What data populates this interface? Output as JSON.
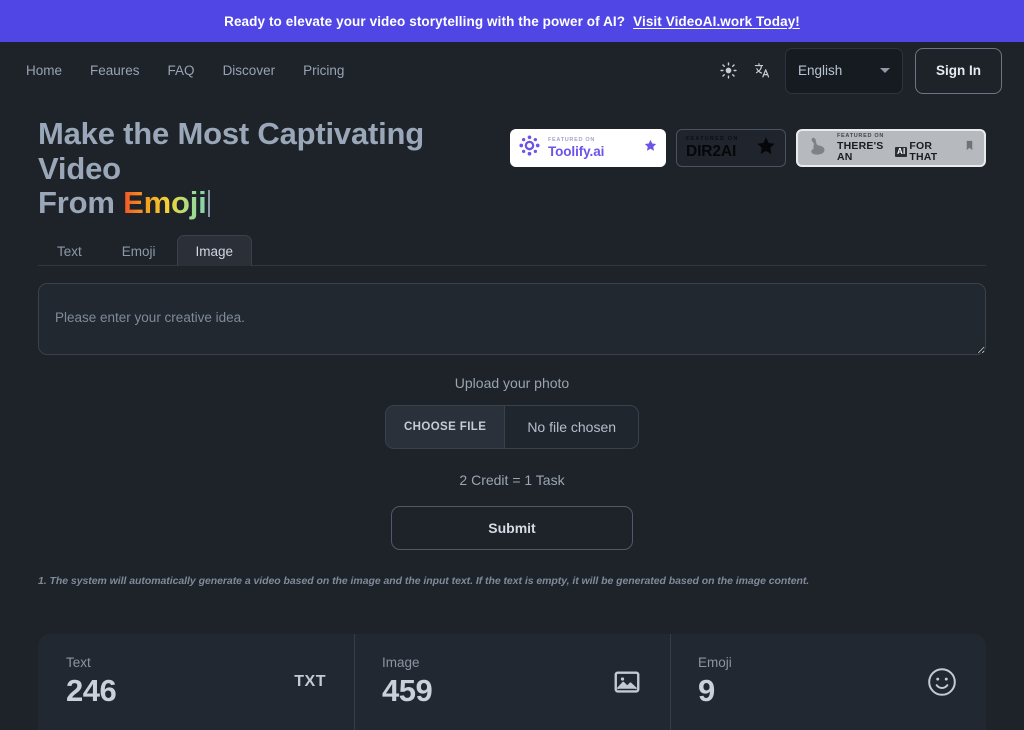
{
  "banner": {
    "text": "Ready to elevate your video storytelling with the power of AI?",
    "link_label": "Visit VideoAI.work Today!",
    "background": "#5046e5"
  },
  "header": {
    "nav": [
      {
        "label": "Home"
      },
      {
        "label": "Feaures"
      },
      {
        "label": "FAQ"
      },
      {
        "label": "Discover"
      },
      {
        "label": "Pricing"
      }
    ],
    "theme_toggle_icon": "sun-icon",
    "translate_icon": "translate-icon",
    "language": {
      "selected": "English",
      "caret_icon": "chevron-down-icon"
    },
    "signin_label": "Sign In"
  },
  "hero": {
    "title_line1": "Make the Most Captivating Video",
    "title_line2_prefix": "From ",
    "title_line2_highlight": "Emoji",
    "highlight_gradient": [
      "#f4542a",
      "#f59f1b",
      "#f2d53a",
      "#a9dd85",
      "#7fd2b0"
    ]
  },
  "badges": [
    {
      "id": "toolify",
      "sub": "FEATURED ON",
      "main": "Toolify.ai",
      "logo_icon": "toolify-gear-icon",
      "trailing_icon": "star-icon",
      "background": "#ffffff",
      "accent": "#6d53e8"
    },
    {
      "id": "dir2ai",
      "sub": "FEATURED ON",
      "main": "DIR2AI",
      "trailing_icon": "star-icon",
      "background": "#20242c",
      "accent": "#05070a"
    },
    {
      "id": "theres-an-ai-for-that",
      "sub": "FEATURED ON",
      "main_part1": "THERE'S AN",
      "main_badge": "AI",
      "main_part2": "FOR THAT",
      "logo_icon": "flexed-arm-icon",
      "trailing_icon": "bookmark-icon",
      "background": "#b6b9be",
      "accent": "#1b1d21"
    }
  ],
  "main": {
    "tabs": [
      {
        "label": "Text",
        "active": false
      },
      {
        "label": "Emoji",
        "active": false
      },
      {
        "label": "Image",
        "active": true
      }
    ],
    "idea_textarea": {
      "placeholder": "Please enter your creative idea.",
      "value": ""
    },
    "upload_label": "Upload your photo",
    "file_input": {
      "button_label": "CHOOSE FILE",
      "file_name": "No file chosen"
    },
    "credit_text": "2 Credit = 1 Task",
    "submit_label": "Submit",
    "footnote": "1. The system will automatically generate a video based on the image and the input text. If the text is empty, it will be generated based on the image content."
  },
  "stats": [
    {
      "label": "Text",
      "value": "246",
      "icon": "txt-file-icon"
    },
    {
      "label": "Image",
      "value": "459",
      "icon": "picture-icon"
    },
    {
      "label": "Emoji",
      "value": "9",
      "icon": "smiley-icon"
    }
  ]
}
